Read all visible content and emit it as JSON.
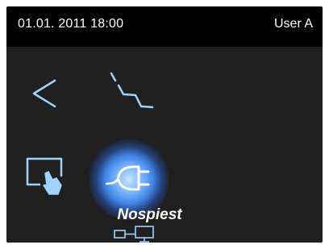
{
  "status_bar": {
    "datetime": "01.01. 2011 18:00",
    "user": "User A"
  },
  "controls": {
    "back": {
      "icon": "chevron-left-icon"
    },
    "link": {
      "icon": "link-line-icon"
    },
    "touch": {
      "icon": "touch-screen-icon"
    },
    "plug": {
      "icon": "power-plug-icon",
      "active": true
    }
  },
  "selected_item": {
    "label": "Nospiest",
    "icon": "network-connection-icon"
  },
  "colors": {
    "background": "#202020",
    "status_bar": "#000000",
    "icon": "#9fd2ff",
    "glow": "#3f84e6",
    "text": "#ffffff"
  }
}
